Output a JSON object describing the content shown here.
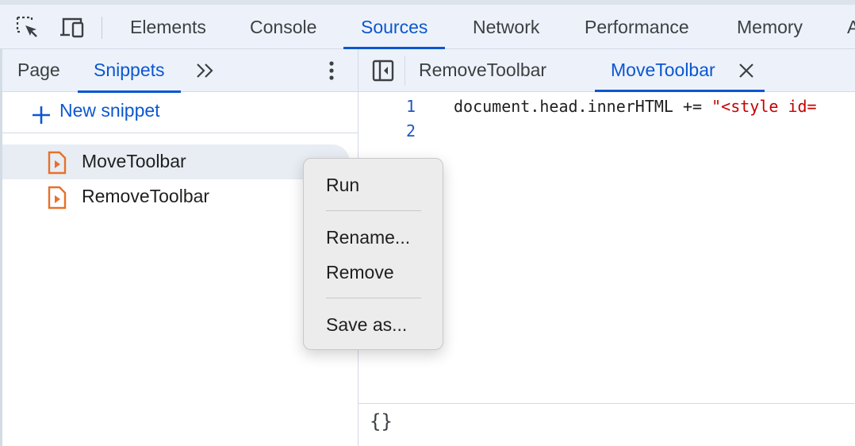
{
  "toolbar": {
    "icons": [
      "inspect-element-icon",
      "device-toolbar-icon"
    ],
    "tabs": [
      {
        "label": "Elements",
        "active": false
      },
      {
        "label": "Console",
        "active": false
      },
      {
        "label": "Sources",
        "active": true
      },
      {
        "label": "Network",
        "active": false
      },
      {
        "label": "Performance",
        "active": false
      },
      {
        "label": "Memory",
        "active": false
      },
      {
        "label": "A",
        "active": false
      }
    ]
  },
  "navigator": {
    "tabs": [
      {
        "label": "Page",
        "active": false
      },
      {
        "label": "Snippets",
        "active": true
      }
    ],
    "more_tabs_icon": "chevron-double-right-icon",
    "more_options_icon": "kebab-menu-icon",
    "new_snippet_label": "New snippet",
    "snippets": [
      {
        "label": "MoveToolbar",
        "selected": true
      },
      {
        "label": "RemoveToolbar",
        "selected": false
      }
    ]
  },
  "editor": {
    "tabs": [
      {
        "label": "RemoveToolbar",
        "active": false
      },
      {
        "label": "MoveToolbar",
        "active": true
      }
    ],
    "line_numbers": [
      "1",
      "2"
    ],
    "code_line1_plain": "document.head.innerHTML += ",
    "code_line1_string": "\"<style id=",
    "code_line2": "",
    "format_button_label": "{}"
  },
  "context_menu": {
    "items": [
      "Run",
      "Rename...",
      "Remove",
      "Save as..."
    ]
  },
  "colors": {
    "accent": "#0b57d0",
    "toolbar_bg": "#edf2fa",
    "snippet_icon": "#e8702a",
    "string": "#c80000"
  }
}
